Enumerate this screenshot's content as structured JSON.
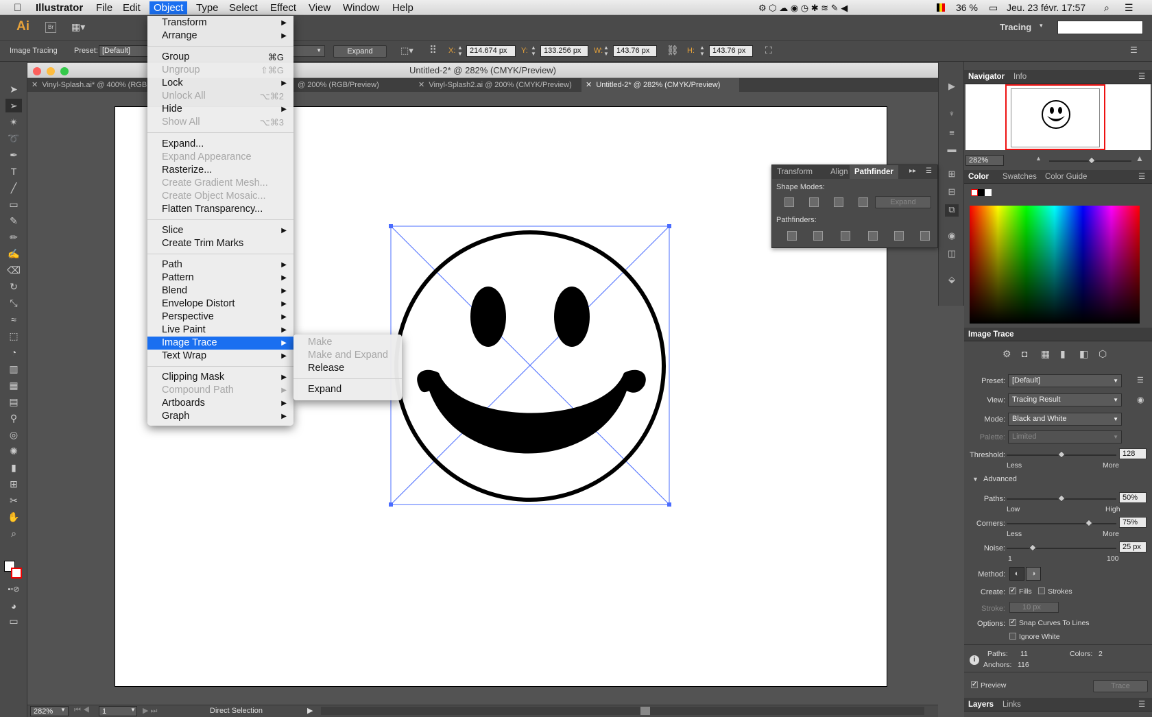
{
  "menubar": {
    "apple": "",
    "app": "Illustrator",
    "items": [
      "File",
      "Edit",
      "Object",
      "Type",
      "Select",
      "Effect",
      "View",
      "Window",
      "Help"
    ],
    "battery": "36 %",
    "datetime": "Jeu. 23 févr.  17:57"
  },
  "appbar": {
    "logo": "Ai",
    "bridge": "Br",
    "workspace": "Tracing"
  },
  "control": {
    "mode_label": "Image Tracing",
    "preset_label": "Preset:",
    "preset_value": "[Default]",
    "expand": "Expand",
    "x_label": "X:",
    "x": "214.674 px",
    "y_label": "Y:",
    "y": "133.256 px",
    "w_label": "W:",
    "w": "143.76 px",
    "h_label": "H:",
    "h": "143.76 px"
  },
  "document": {
    "title": "Untitled-2* @ 282% (CMYK/Preview)",
    "tabs": [
      "Vinyl-Splash.ai* @ 400% (RGB",
      "@ 200% (RGB/Preview)",
      "Vinyl-Splash2.ai @ 200% (CMYK/Preview)",
      "Untitled-2* @ 282% (CMYK/Preview)"
    ]
  },
  "object_menu": {
    "transform": "Transform",
    "arrange": "Arrange",
    "group": "Group",
    "group_sc": "⌘G",
    "ungroup": "Ungroup",
    "ungroup_sc": "⇧⌘G",
    "lock": "Lock",
    "unlock_all": "Unlock All",
    "unlock_sc": "⌥⌘2",
    "hide": "Hide",
    "show_all": "Show All",
    "show_sc": "⌥⌘3",
    "expand": "Expand...",
    "expand_appearance": "Expand Appearance",
    "rasterize": "Rasterize...",
    "gradient_mesh": "Create Gradient Mesh...",
    "object_mosaic": "Create Object Mosaic...",
    "flatten": "Flatten Transparency...",
    "slice": "Slice",
    "trim_marks": "Create Trim Marks",
    "path": "Path",
    "pattern": "Pattern",
    "blend": "Blend",
    "envelope": "Envelope Distort",
    "perspective": "Perspective",
    "live_paint": "Live Paint",
    "image_trace": "Image Trace",
    "text_wrap": "Text Wrap",
    "clipping_mask": "Clipping Mask",
    "compound_path": "Compound Path",
    "artboards": "Artboards",
    "graph": "Graph"
  },
  "image_trace_submenu": {
    "make": "Make",
    "make_expand": "Make and Expand",
    "release": "Release",
    "expand": "Expand"
  },
  "pathfinder_panel": {
    "tabs": [
      "Transform",
      "Align",
      "Pathfinder"
    ],
    "shape_modes": "Shape Modes:",
    "expand": "Expand",
    "pathfinders": "Pathfinders:"
  },
  "navigator": {
    "tabs": [
      "Navigator",
      "Info"
    ],
    "zoom": "282%"
  },
  "color_panel": {
    "tabs": [
      "Color",
      "Swatches",
      "Color Guide"
    ]
  },
  "image_trace_panel": {
    "title": "Image Trace",
    "preset_label": "Preset:",
    "preset": "[Default]",
    "view_label": "View:",
    "view": "Tracing Result",
    "mode_label": "Mode:",
    "mode": "Black and White",
    "palette_label": "Palette:",
    "palette": "Limited",
    "threshold_label": "Threshold:",
    "threshold": "128",
    "threshold_fraction": 0.5,
    "less": "Less",
    "more": "More",
    "advanced": "Advanced",
    "paths_label": "Paths:",
    "paths": "50%",
    "paths_fraction": 0.5,
    "low": "Low",
    "high": "High",
    "corners_label": "Corners:",
    "corners": "75%",
    "corners_fraction": 0.75,
    "noise_label": "Noise:",
    "noise": "25 px",
    "noise_fraction": 0.24,
    "noise_min": "1",
    "noise_max": "100",
    "method_label": "Method:",
    "create_label": "Create:",
    "fills": "Fills",
    "strokes": "Strokes",
    "stroke_label": "Stroke:",
    "stroke": "10 px",
    "options_label": "Options:",
    "snap": "Snap Curves To Lines",
    "ignore_white": "Ignore White",
    "paths_count_label": "Paths:",
    "paths_count": "11",
    "colors_label": "Colors:",
    "colors": "2",
    "anchors_label": "Anchors:",
    "anchors": "116",
    "preview": "Preview",
    "trace": "Trace"
  },
  "layers": {
    "tabs": [
      "Layers",
      "Links"
    ]
  },
  "status": {
    "zoom": "282%",
    "artboard": "1",
    "tool": "Direct Selection"
  }
}
